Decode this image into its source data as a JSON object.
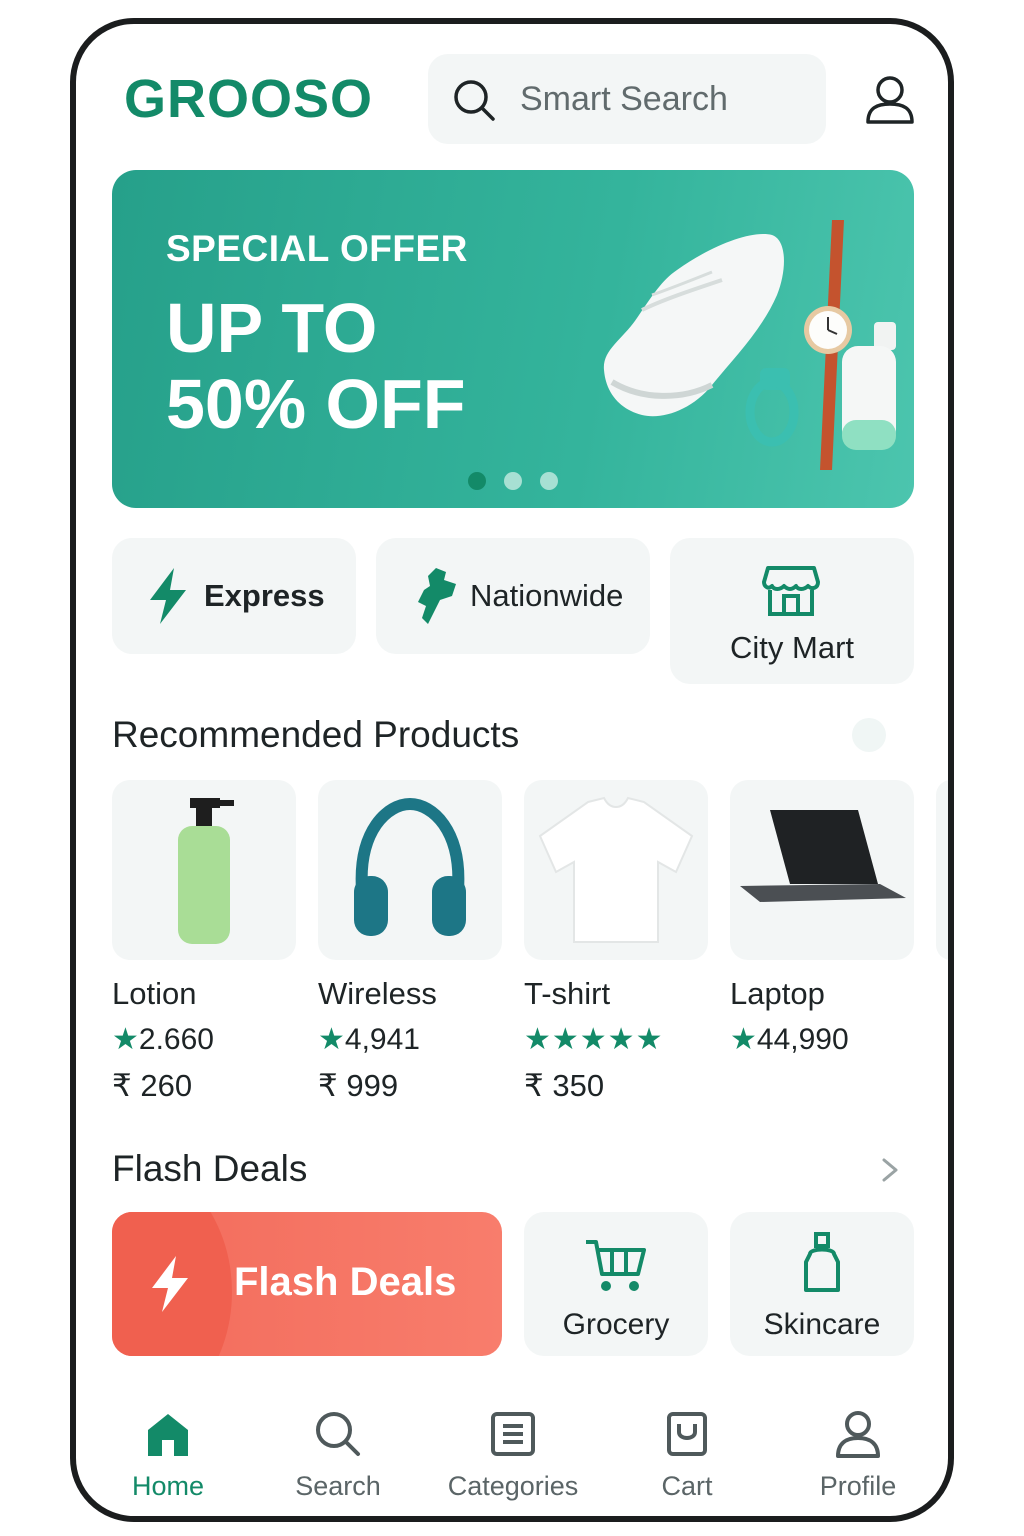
{
  "app": {
    "logo": "GROOSO"
  },
  "search": {
    "placeholder": "Smart Search"
  },
  "banner": {
    "subtitle": "SPECIAL OFFER",
    "headline_line1": "UP TO",
    "headline_line2": "50% OFF",
    "active_slide": 1,
    "slide_count": 3
  },
  "chips": [
    {
      "label": "Express",
      "icon": "lightning-icon"
    },
    {
      "label": "Nationwide",
      "icon": "map-icon"
    },
    {
      "label": "City Mart",
      "icon": "store-icon"
    }
  ],
  "recommended": {
    "title": "Recommended Products",
    "products": [
      {
        "name": "Lotion",
        "rating": "2.660",
        "price": "₹ 260"
      },
      {
        "name": "Wireless",
        "rating": "4,941",
        "price": "₹ 999"
      },
      {
        "name": "T-shirt",
        "rating": "",
        "stars": 5,
        "price": "₹ 350"
      },
      {
        "name": "Laptop",
        "rating": "44,990",
        "price": ""
      }
    ]
  },
  "flash": {
    "title": "Flash Deals",
    "banner_label": "Flash Deals",
    "cards": [
      {
        "label": "Grocery",
        "icon": "cart-icon"
      },
      {
        "label": "Skincare",
        "icon": "bottle-icon"
      }
    ]
  },
  "tabs": [
    {
      "label": "Home",
      "icon": "home-icon",
      "active": true
    },
    {
      "label": "Search",
      "icon": "search-icon",
      "active": false
    },
    {
      "label": "Categories",
      "icon": "list-icon",
      "active": false
    },
    {
      "label": "Cart",
      "icon": "bag-icon",
      "active": false
    },
    {
      "label": "Profile",
      "icon": "user-icon",
      "active": false
    }
  ],
  "colors": {
    "brand": "#138a68",
    "banner": "#2fab93",
    "flash": "#f6796a",
    "card_bg": "#f3f6f6"
  }
}
